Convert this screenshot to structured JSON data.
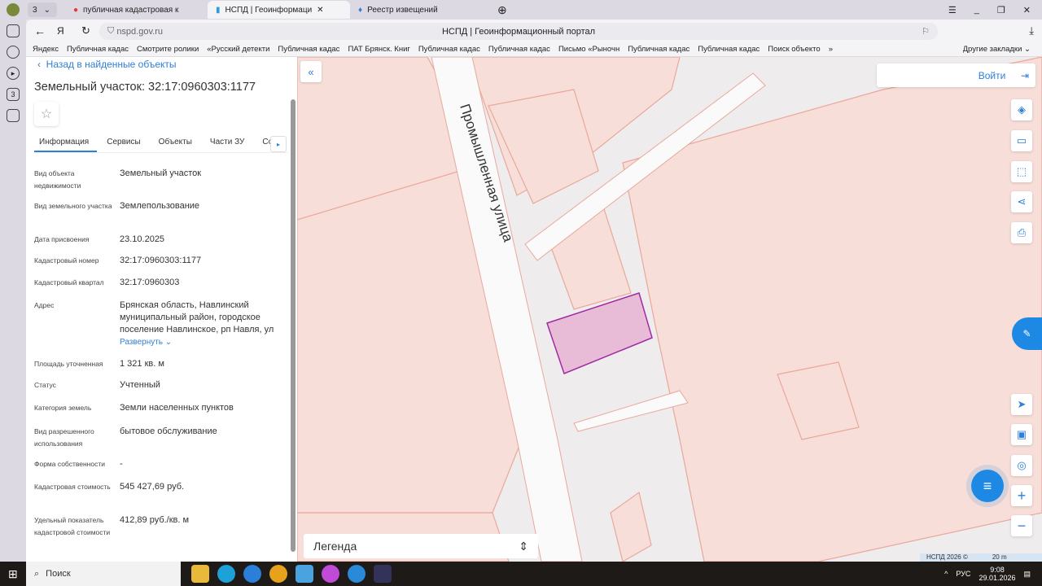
{
  "browser": {
    "tab_count": "3",
    "tabs": [
      "публичная кадастровая к",
      "НСПД | Геоинформаци",
      "Реестр извещений"
    ],
    "url": "nspd.gov.ru",
    "page_title": "НСПД | Геоинформационный портал",
    "bookmarks": [
      "Яндекс",
      "Публичная кадас",
      "Смотрите ролики",
      "«Русский детекти",
      "Публичная кадас",
      "ПАТ Брянск. Книг",
      "Публичная кадас",
      "Публичная кадас",
      "Письмо «Рыночн",
      "Публичная кадас",
      "Публичная кадас",
      "Поиск объекто"
    ],
    "other_bookmarks": "Другие закладки"
  },
  "panel": {
    "back": "Назад в найденные объекты",
    "title": "Земельный участок: 32:17:0960303:1177",
    "tabs": [
      "Информация",
      "Сервисы",
      "Объекты",
      "Части ЗУ",
      "Соста"
    ],
    "fields": [
      {
        "k": "Вид объекта недвижимости",
        "v": "Земельный участок"
      },
      {
        "k": "Вид земельного участка",
        "v": "Землепользование"
      },
      {
        "k": "Дата присвоения",
        "v": "23.10.2025"
      },
      {
        "k": "Кадастровый номер",
        "v": "32:17:0960303:1177"
      },
      {
        "k": "Кадастровый квартал",
        "v": "32:17:0960303"
      },
      {
        "k": "Адрес",
        "v": "Брянская область, Навлинский муниципальный район, городское поселение Навлинское, рп Навля, ул"
      },
      {
        "k": "Площадь уточненная",
        "v": "1 321 кв. м"
      },
      {
        "k": "Статус",
        "v": "Учтенный"
      },
      {
        "k": "Категория земель",
        "v": "Земли населенных пунктов"
      },
      {
        "k": "Вид разрешенного использования",
        "v": "бытовое обслуживание"
      },
      {
        "k": "Форма собственности",
        "v": "-"
      },
      {
        "k": "Кадастровая стоимость",
        "v": "545 427,69 руб."
      },
      {
        "k": "Удельный показатель кадастровой стоимости",
        "v": "412,89 руб./кв. м"
      }
    ],
    "expand": "Развернуть"
  },
  "map": {
    "street": "Промышленная улица",
    "login": "Войти",
    "legend": "Легенда",
    "copyright": "НСПД 2026 ©",
    "scale": "20 m"
  },
  "taskbar": {
    "search": "Поиск",
    "lang": "РУС",
    "time": "9:08",
    "date": "29.01.2026"
  }
}
